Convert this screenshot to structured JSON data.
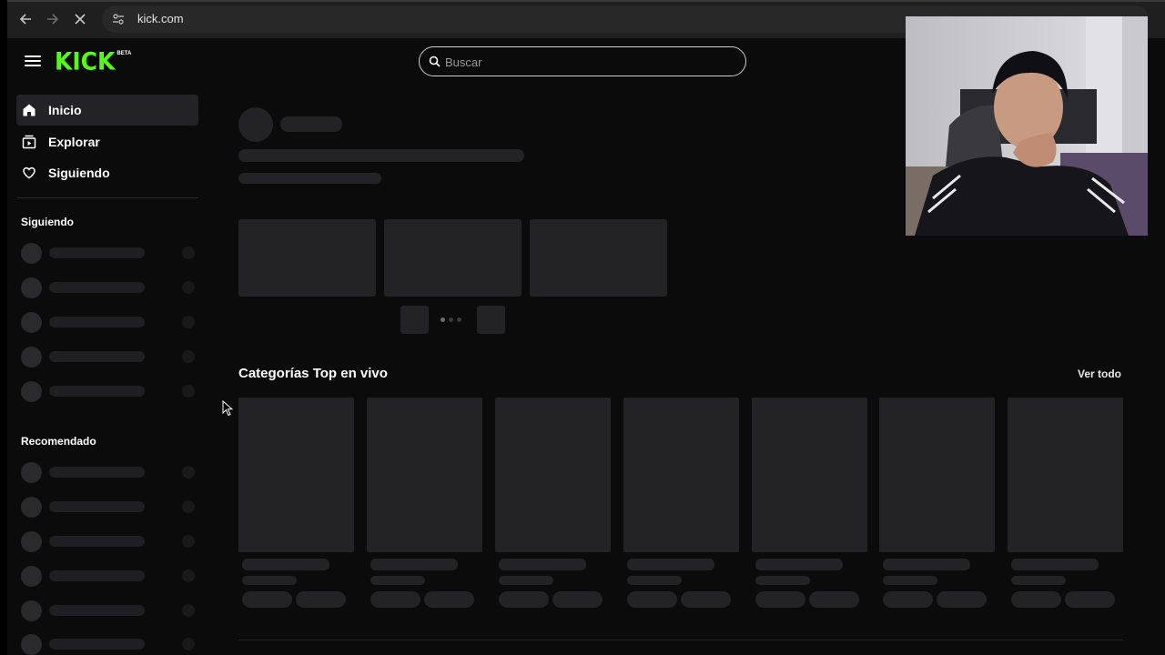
{
  "browser": {
    "url": "kick.com"
  },
  "site": {
    "logo_text": "KICK",
    "logo_badge": "BETA",
    "search_placeholder": "Buscar",
    "brand_color": "#53fc18"
  },
  "sidebar": {
    "nav": [
      {
        "label": "Inicio",
        "icon": "home-icon",
        "active": true
      },
      {
        "label": "Explorar",
        "icon": "explore-icon",
        "active": false
      },
      {
        "label": "Siguiendo",
        "icon": "heart-icon",
        "active": false
      }
    ],
    "following_heading": "Siguiendo",
    "recommended_heading": "Recomendado"
  },
  "main": {
    "top_categories_title": "Categorías Top en vivo",
    "see_all_label": "Ver todo"
  }
}
